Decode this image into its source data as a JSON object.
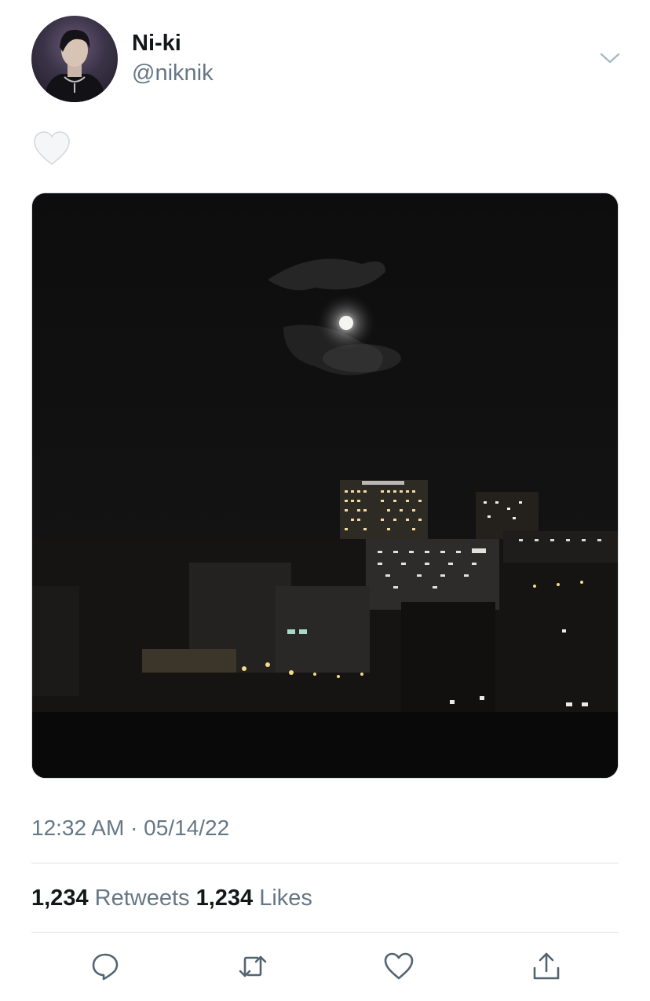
{
  "tweet": {
    "display_name": "Ni-ki",
    "handle": "@niknik",
    "body_emoji": "white-heart",
    "timestamp": "12:32 AM · 05/14/22",
    "retweets_count": "1,234",
    "retweets_label": "Retweets",
    "likes_count": "1,234",
    "likes_label": "Likes"
  },
  "icons": {
    "header_menu": "chevron-down-icon",
    "reply": "reply-icon",
    "retweet": "retweet-icon",
    "like": "heart-icon",
    "share": "share-icon"
  },
  "colors": {
    "primary_text": "#14171a",
    "secondary_text": "#657786",
    "divider": "#dfe3e7",
    "icon": "#536471"
  }
}
